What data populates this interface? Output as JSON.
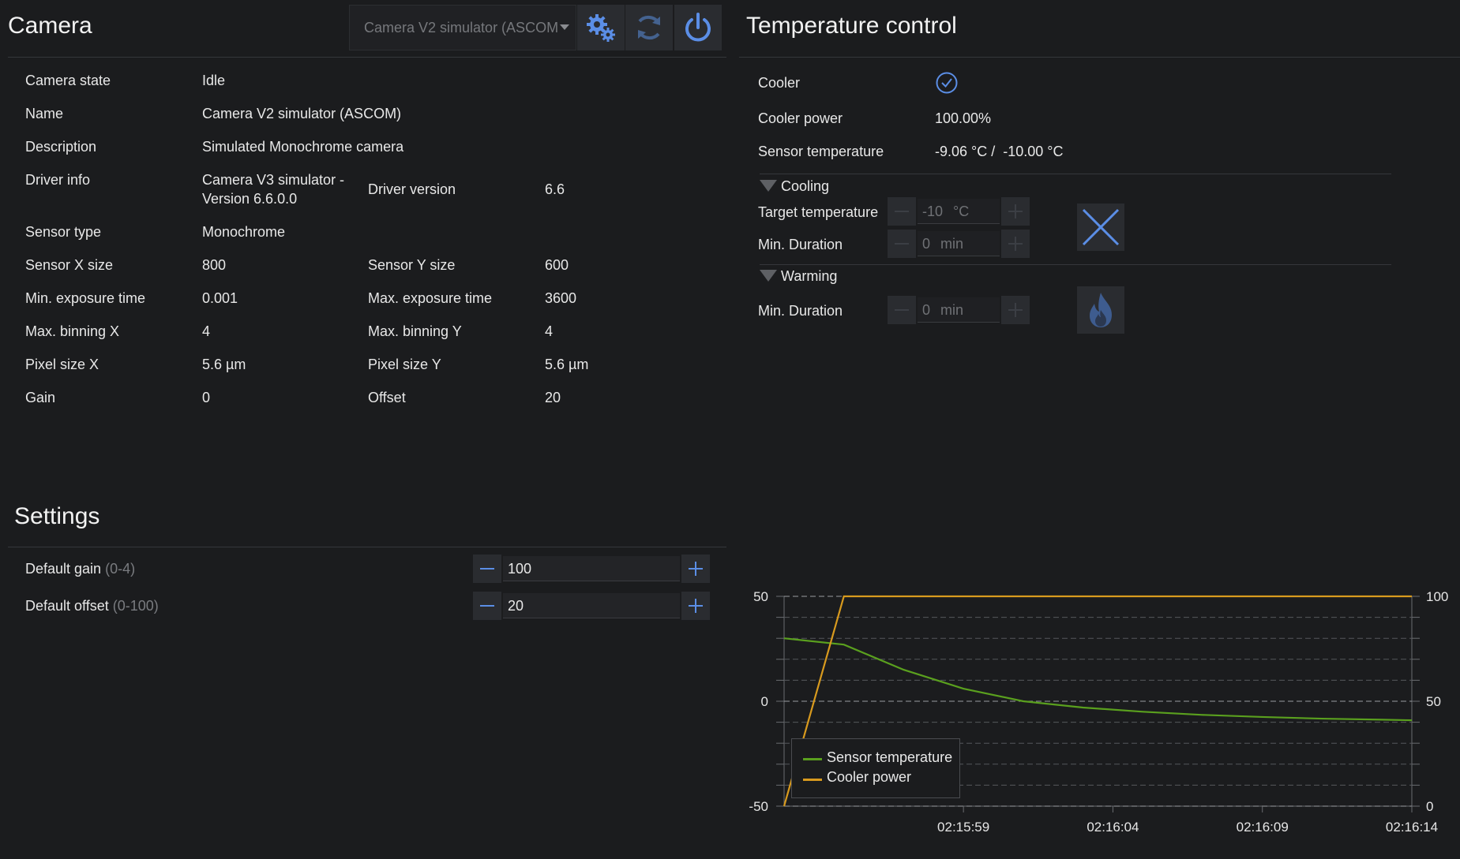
{
  "camera": {
    "title": "Camera",
    "selector_value": "Camera V2 simulator (ASCOM",
    "icons": {
      "settings": "gears-icon",
      "refresh": "refresh-icon",
      "power": "power-icon"
    },
    "info": {
      "camera_state_label": "Camera state",
      "camera_state_value": "Idle",
      "name_label": "Name",
      "name_value": "Camera V2 simulator (ASCOM)",
      "description_label": "Description",
      "description_value": "Simulated Monochrome camera",
      "driver_info_label": "Driver info",
      "driver_info_value_line1": "Camera V3 simulator -",
      "driver_info_value_line2": "Version 6.6.0.0",
      "driver_version_label": "Driver version",
      "driver_version_value": "6.6",
      "sensor_type_label": "Sensor type",
      "sensor_type_value": "Monochrome",
      "sensor_x_label": "Sensor X size",
      "sensor_x_value": "800",
      "sensor_y_label": "Sensor Y size",
      "sensor_y_value": "600",
      "min_exp_label": "Min. exposure time",
      "min_exp_value": "0.001",
      "max_exp_label": "Max. exposure time",
      "max_exp_value": "3600",
      "max_bin_x_label": "Max. binning X",
      "max_bin_x_value": "4",
      "max_bin_y_label": "Max. binning Y",
      "max_bin_y_value": "4",
      "pixel_x_label": "Pixel size X",
      "pixel_x_value": "5.6 µm",
      "pixel_y_label": "Pixel size Y",
      "pixel_y_value": "5.6 µm",
      "gain_label": "Gain",
      "gain_value": "0",
      "offset_label": "Offset",
      "offset_value": "20"
    }
  },
  "settings": {
    "title": "Settings",
    "default_gain_label": "Default gain",
    "default_gain_range": "(0-4)",
    "default_gain_value": "100",
    "default_offset_label": "Default offset",
    "default_offset_range": "(0-100)",
    "default_offset_value": "20"
  },
  "temperature": {
    "title": "Temperature control",
    "cooler_label": "Cooler",
    "cooler_power_label": "Cooler power",
    "cooler_power_value": "100.00%",
    "sensor_temp_label": "Sensor temperature",
    "sensor_temp_value": "-9.06 °C /  -10.00 °C",
    "cooling_header": "Cooling",
    "target_temp_label": "Target temperature",
    "target_temp_value": "-10",
    "target_temp_unit": "°C",
    "cool_min_duration_label": "Min. Duration",
    "cool_min_duration_value": "0",
    "cool_min_duration_unit": "min",
    "warming_header": "Warming",
    "warm_min_duration_label": "Min. Duration",
    "warm_min_duration_value": "0",
    "warm_min_duration_unit": "min"
  },
  "colors": {
    "accent": "#5b8ee6",
    "sensor_line": "#5aa01e",
    "power_line": "#d89a1e"
  },
  "chart_data": {
    "type": "line",
    "x": [
      "02:15:53",
      "02:15:55",
      "02:15:57",
      "02:15:59",
      "02:16:01",
      "02:16:03",
      "02:16:05",
      "02:16:07",
      "02:16:09",
      "02:16:11",
      "02:16:13",
      "02:16:14"
    ],
    "x_tick_labels": [
      "02:15:59",
      "02:16:04",
      "02:16:09",
      "02:16:14"
    ],
    "series": [
      {
        "name": "Sensor temperature",
        "axis": "left",
        "values": [
          30,
          27,
          15,
          6,
          0,
          -3,
          -5,
          -6.5,
          -7.5,
          -8.3,
          -8.8,
          -9.06
        ]
      },
      {
        "name": "Cooler power",
        "axis": "right",
        "values": [
          0,
          100,
          100,
          100,
          100,
          100,
          100,
          100,
          100,
          100,
          100,
          100
        ]
      }
    ],
    "ylim_left": [
      -50,
      50
    ],
    "ylim_right": [
      0,
      100
    ],
    "y_ticks_left": [
      "50",
      "0",
      "-50"
    ],
    "y_ticks_right": [
      "100",
      "50",
      "0"
    ],
    "grid": true,
    "legend_position": "bottom-left"
  }
}
